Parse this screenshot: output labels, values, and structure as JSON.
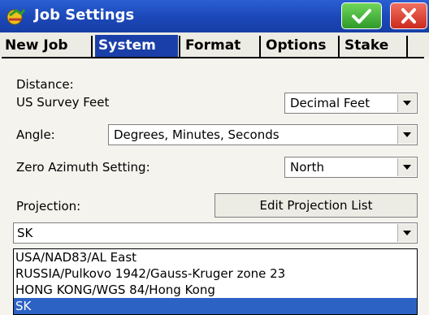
{
  "window": {
    "title": "Job Settings"
  },
  "tabs": [
    {
      "label": "New Job",
      "active": false
    },
    {
      "label": "System",
      "active": true
    },
    {
      "label": "Format",
      "active": false
    },
    {
      "label": "Options",
      "active": false
    },
    {
      "label": "Stake",
      "active": false
    }
  ],
  "distance": {
    "label": "Distance:",
    "unit_text": "US Survey Feet",
    "format_value": "Decimal Feet"
  },
  "angle": {
    "label": "Angle:",
    "value": "Degrees, Minutes, Seconds"
  },
  "zero_azimuth": {
    "label": "Zero Azimuth Setting:",
    "value": "North"
  },
  "projection": {
    "label": "Projection:",
    "edit_button": "Edit Projection List",
    "value": "SK",
    "options": [
      "USA/NAD83/AL East",
      "RUSSIA/Pulkovo 1942/Gauss-Kruger zone 23",
      "HONG KONG/WGS 84/Hong Kong",
      "SK"
    ],
    "selected": "SK"
  },
  "colors": {
    "titlebar": "#1b47b8",
    "active_tab": "#1a3fa8",
    "selection": "#2d62c5",
    "ok": "#3aa32f",
    "close": "#d8352a"
  }
}
